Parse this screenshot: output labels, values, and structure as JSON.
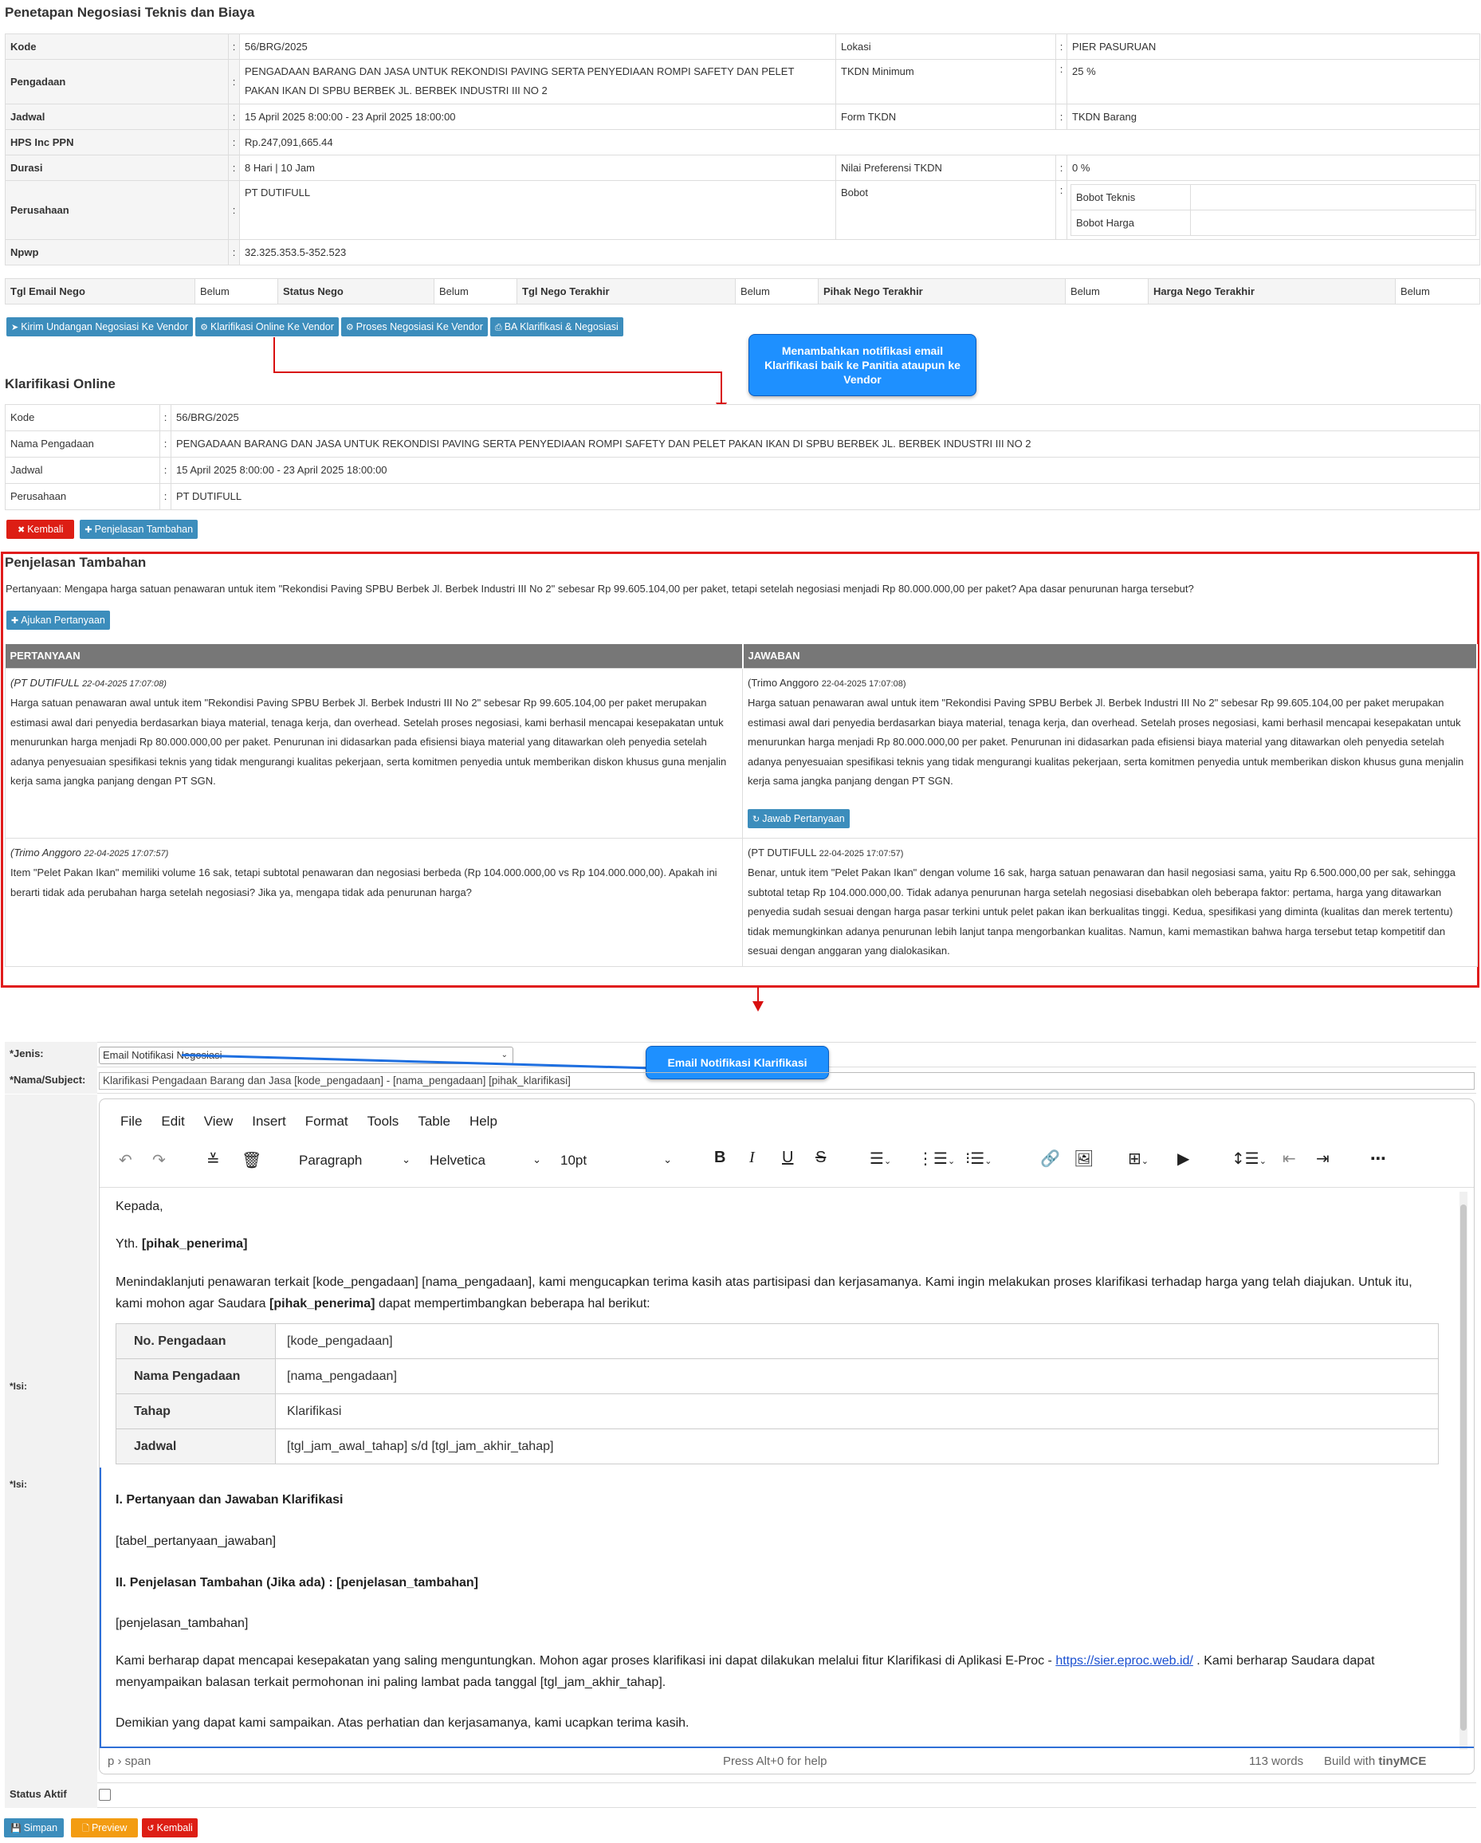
{
  "page_title": "Penetapan Negosiasi Teknis dan Biaya",
  "detail": {
    "kode_label": "Kode",
    "kode": "56/BRG/2025",
    "lokasi_label": "Lokasi",
    "lokasi": "PIER PASURUAN",
    "pengadaan_label": "Pengadaan",
    "pengadaan": "PENGADAAN BARANG DAN JASA UNTUK REKONDISI PAVING SERTA PENYEDIAAN ROMPI SAFETY DAN PELET PAKAN IKAN DI SPBU BERBEK JL. BERBEK INDUSTRI III NO 2",
    "tkdn_min_label": "TKDN Minimum",
    "tkdn_min": "25 %",
    "jadwal_label": "Jadwal",
    "jadwal": "15 April 2025 8:00:00 - 23 April 2025 18:00:00",
    "form_tkdn_label": "Form TKDN",
    "form_tkdn": "TKDN Barang",
    "hps_label": "HPS Inc PPN",
    "hps": "Rp.247,091,665.44",
    "durasi_label": "Durasi",
    "durasi": "8 Hari | 10 Jam",
    "nilai_pref_label": "Nilai Preferensi TKDN",
    "nilai_pref": "0 %",
    "perusahaan_label": "Perusahaan",
    "perusahaan": "PT DUTIFULL",
    "bobot_label": "Bobot",
    "bobot_teknis_label": "Bobot Teknis",
    "bobot_harga_label": "Bobot Harga",
    "npwp_label": "Npwp",
    "npwp": "32.325.353.5-352.523",
    "colon": ":"
  },
  "status_row": [
    {
      "label": "Tgl Email Nego",
      "value": "Belum"
    },
    {
      "label": "Status Nego",
      "value": "Belum"
    },
    {
      "label": "Tgl Nego Terakhir",
      "value": "Belum"
    },
    {
      "label": "Pihak Nego Terakhir",
      "value": "Belum"
    },
    {
      "label": "Harga Nego Terakhir",
      "value": "Belum"
    }
  ],
  "actions": {
    "kirim": "Kirim Undangan Negosiasi Ke Vendor",
    "klarifikasi": "Klarifikasi Online Ke Vendor",
    "proses": "Proses Negosiasi Ke Vendor",
    "ba": "BA Klarifikasi & Negosiasi"
  },
  "callout1": "Menambahkan notifikasi email Klarifikasi baik ke Panitia ataupun ke Vendor",
  "callout2": "Email Notifikasi Klarifikasi",
  "klarifikasi": {
    "title": "Klarifikasi Online",
    "rows": [
      {
        "label": "Kode",
        "value": "56/BRG/2025"
      },
      {
        "label": "Nama Pengadaan",
        "value": "PENGADAAN BARANG DAN JASA UNTUK REKONDISI PAVING SERTA PENYEDIAAN ROMPI SAFETY DAN PELET PAKAN IKAN DI SPBU BERBEK JL. BERBEK INDUSTRI III NO 2"
      },
      {
        "label": "Jadwal",
        "value": "15 April 2025 8:00:00 - 23 April 2025 18:00:00"
      },
      {
        "label": "Perusahaan",
        "value": "PT DUTIFULL"
      }
    ],
    "kembali": "Kembali",
    "penjelasan_btn": "Penjelasan Tambahan"
  },
  "penjelasan": {
    "title": "Penjelasan Tambahan",
    "pertanyaan": "Pertanyaan: Mengapa harga satuan penawaran untuk item \"Rekondisi Paving SPBU Berbek Jl. Berbek Industri III No 2\" sebesar Rp 99.605.104,00 per paket, tetapi setelah negosiasi menjadi Rp 80.000.000,00 per paket? Apa dasar penurunan harga tersebut?",
    "ajukan": "Ajukan Pertanyaan",
    "col_q": "PERTANYAAN",
    "col_a": "JAWABAN",
    "rows": [
      {
        "q_who": "(PT DUTIFULL",
        "q_when": "22-04-2025 17:07:08)",
        "q_text": "Harga satuan penawaran awal untuk item \"Rekondisi Paving SPBU Berbek Jl. Berbek Industri III No 2\" sebesar Rp 99.605.104,00 per paket merupakan estimasi awal dari penyedia berdasarkan biaya material, tenaga kerja, dan overhead. Setelah proses negosiasi, kami berhasil mencapai kesepakatan untuk menurunkan harga menjadi Rp 80.000.000,00 per paket. Penurunan ini didasarkan pada efisiensi biaya material yang ditawarkan oleh penyedia setelah adanya penyesuaian spesifikasi teknis yang tidak mengurangi kualitas pekerjaan, serta komitmen penyedia untuk memberikan diskon khusus guna menjalin kerja sama jangka panjang dengan PT SGN.",
        "a_who": "(Trimo Anggoro",
        "a_when": "22-04-2025 17:07:08)",
        "a_text": "Harga satuan penawaran awal untuk item \"Rekondisi Paving SPBU Berbek Jl. Berbek Industri III No 2\" sebesar Rp 99.605.104,00 per paket merupakan estimasi awal dari penyedia berdasarkan biaya material, tenaga kerja, dan overhead. Setelah proses negosiasi, kami berhasil mencapai kesepakatan untuk menurunkan harga menjadi Rp 80.000.000,00 per paket. Penurunan ini didasarkan pada efisiensi biaya material yang ditawarkan oleh penyedia setelah adanya penyesuaian spesifikasi teknis yang tidak mengurangi kualitas pekerjaan, serta komitmen penyedia untuk memberikan diskon khusus guna menjalin kerja sama jangka panjang dengan PT SGN.",
        "jawab_btn": "Jawab Pertanyaan"
      },
      {
        "q_who": "(Trimo Anggoro",
        "q_when": "22-04-2025 17:07:57)",
        "q_text": "Item \"Pelet Pakan Ikan\" memiliki volume 16 sak, tetapi subtotal penawaran dan negosiasi berbeda (Rp 104.000.000,00 vs Rp 104.000.000,00). Apakah ini berarti tidak ada perubahan harga setelah negosiasi? Jika ya, mengapa tidak ada penurunan harga?",
        "a_who": "(PT DUTIFULL",
        "a_when": "22-04-2025 17:07:57)",
        "a_text": "Benar, untuk item \"Pelet Pakan Ikan\" dengan volume 16 sak, harga satuan penawaran dan hasil negosiasi sama, yaitu Rp 6.500.000,00 per sak, sehingga subtotal tetap Rp 104.000.000,00. Tidak adanya penurunan harga setelah negosiasi disebabkan oleh beberapa faktor: pertama, harga yang ditawarkan penyedia sudah sesuai dengan harga pasar terkini untuk pelet pakan ikan berkualitas tinggi. Kedua, spesifikasi yang diminta (kualitas dan merek tertentu) tidak memungkinkan adanya penurunan lebih lanjut tanpa mengorbankan kualitas. Namun, kami memastikan bahwa harga tersebut tetap kompetitif dan sesuai dengan anggaran yang dialokasikan."
      }
    ]
  },
  "form": {
    "jenis_label": "*Jenis:",
    "jenis_value": "Email Notifikasi Negosiasi",
    "subject_label": "*Nama/Subject:",
    "subject_value": "Klarifikasi Pengadaan Barang dan Jasa [kode_pengadaan] - [nama_pengadaan] [pihak_klarifikasi]",
    "isi_label": "*Isi:",
    "isi_label2": "*Isi:",
    "status_label": "Status Aktif",
    "simpan": "Simpan",
    "preview": "Preview",
    "kembali": "Kembali"
  },
  "editor": {
    "menu": [
      "File",
      "Edit",
      "View",
      "Insert",
      "Format",
      "Tools",
      "Table",
      "Help"
    ],
    "block_format": "Paragraph",
    "font": "Helvetica",
    "size": "10pt",
    "kepada": "Kepada,",
    "yth": "Yth.",
    "penerima": "[pihak_penerima]",
    "para1_a": "Menindaklanjuti penawaran terkait [kode_pengadaan] [nama_pengadaan], kami mengucapkan terima kasih atas partisipasi dan kerjasamanya. Kami ingin melakukan proses klarifikasi terhadap harga yang telah diajukan. Untuk itu, kami mohon agar Saudara",
    "para1_b": "dapat mempertimbangkan beberapa hal berikut:",
    "table": [
      {
        "label": "No. Pengadaan",
        "value": "[kode_pengadaan]"
      },
      {
        "label": "Nama Pengadaan",
        "value": "[nama_pengadaan]"
      },
      {
        "label": "Tahap",
        "value": "Klarifikasi"
      },
      {
        "label": "Jadwal",
        "value": "[tgl_jam_awal_tahap] s/d [tgl_jam_akhir_tahap]"
      }
    ],
    "h1": "I. Pertanyaan dan Jawaban Klarifikasi",
    "tabel_qa": "[tabel_pertanyaan_jawaban]",
    "h2": "II. Penjelasan Tambahan (Jika ada) : [penjelasan_tambahan]",
    "penjelasan": "[penjelasan_tambahan]",
    "para2_a": "Kami berharap dapat mencapai kesepakatan yang saling menguntungkan. Mohon agar proses klarifikasi ini dapat dilakukan melalui fitur Klarifikasi di Aplikasi E-Proc -",
    "link": "https://sier.eproc.web.id/",
    "para2_b": ". Kami berharap Saudara dapat menyampaikan balasan terkait permohonan ini paling lambat pada tanggal [tgl_jam_akhir_tahap].",
    "closing": "Demikian yang dapat kami sampaikan. Atas perhatian dan kerjasamanya, kami ucapkan terima kasih.",
    "path": "p › span",
    "help": "Press Alt+0 for help",
    "words": "113 words",
    "build": "Build with",
    "brand": "tinyMCE"
  }
}
